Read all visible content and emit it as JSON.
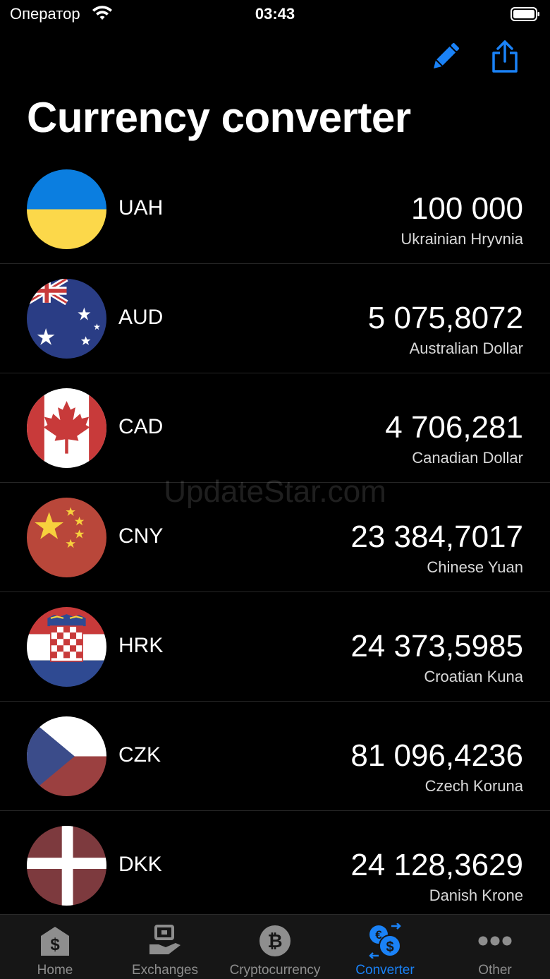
{
  "status_bar": {
    "carrier": "Оператор",
    "time": "03:43"
  },
  "header": {
    "title": "Currency converter"
  },
  "colors": {
    "accent": "#1a82f7",
    "inactive_tab": "#8e8e8e",
    "background": "#000000"
  },
  "currencies": [
    {
      "code": "UAH",
      "amount": "100 000",
      "name": "Ukrainian Hryvnia",
      "flag": "ukraine-flag"
    },
    {
      "code": "AUD",
      "amount": "5 075,8072",
      "name": "Australian Dollar",
      "flag": "australia-flag"
    },
    {
      "code": "CAD",
      "amount": "4 706,281",
      "name": "Canadian Dollar",
      "flag": "canada-flag"
    },
    {
      "code": "CNY",
      "amount": "23 384,7017",
      "name": "Chinese Yuan",
      "flag": "china-flag"
    },
    {
      "code": "HRK",
      "amount": "24 373,5985",
      "name": "Croatian Kuna",
      "flag": "croatia-flag"
    },
    {
      "code": "CZK",
      "amount": "81 096,4236",
      "name": "Czech Koruna",
      "flag": "czech-flag"
    },
    {
      "code": "DKK",
      "amount": "24 128,3629",
      "name": "Danish Krone",
      "flag": "denmark-flag"
    }
  ],
  "watermark": "UpdateStar.com",
  "tabs": [
    {
      "label": "Home",
      "icon": "dollar-house-icon"
    },
    {
      "label": "Exchanges",
      "icon": "exchange-hand-icon"
    },
    {
      "label": "Cryptocurrency",
      "icon": "bitcoin-icon"
    },
    {
      "label": "Converter",
      "icon": "currency-convert-icon",
      "active": true
    },
    {
      "label": "Other",
      "icon": "more-dots-icon"
    }
  ]
}
